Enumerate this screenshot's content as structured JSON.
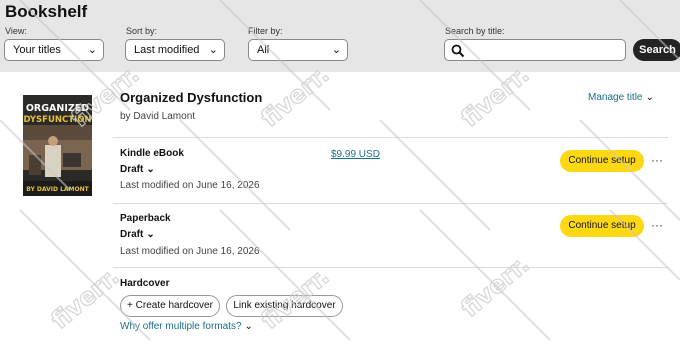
{
  "header": {
    "title": "Bookshelf",
    "view_label": "View:",
    "view_value": "Your titles",
    "sort_label": "Sort by:",
    "sort_value": "Last modified",
    "filter_label": "Filter by:",
    "filter_value": "All",
    "search_label": "Search by title:",
    "search_value": "",
    "search_button": "Search"
  },
  "book": {
    "cover_title_line1": "ORGANIZED",
    "cover_title_line2": "DYSFUNCTION",
    "cover_author": "BY DAVID LAMONT",
    "title": "Organized Dysfunction",
    "author": "by David Lamont",
    "manage_label": "Manage title"
  },
  "formats": [
    {
      "name": "Kindle eBook",
      "status": "Draft",
      "modified": "Last modified on June 16, 2026",
      "price": "$9.99 USD",
      "action": "Continue setup",
      "more": "···"
    },
    {
      "name": "Paperback",
      "status": "Draft",
      "modified": "Last modified on June 16, 2026",
      "action": "Continue setup",
      "more": "···"
    }
  ],
  "hardcover": {
    "name": "Hardcover",
    "create_label": "+ Create hardcover",
    "link_label": "Link existing hardcover"
  },
  "why_link": "Why offer multiple formats?",
  "watermark_text": "fiverr.",
  "colors": {
    "top_bar": "#e6e6e6",
    "accent_link": "#1c6f83",
    "primary_button": "#ffd814",
    "search_button": "#232323"
  }
}
